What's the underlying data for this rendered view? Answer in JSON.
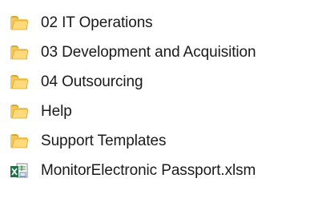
{
  "explorer": {
    "items": [
      {
        "name": "02 IT Operations",
        "icon": "folder-icon"
      },
      {
        "name": "03 Development and Acquisition",
        "icon": "folder-icon"
      },
      {
        "name": "04 Outsourcing",
        "icon": "folder-icon"
      },
      {
        "name": "Help",
        "icon": "folder-icon"
      },
      {
        "name": "Support Templates",
        "icon": "folder-icon"
      },
      {
        "name": "MonitorElectronic Passport.xlsm",
        "icon": "excel-macro-file-icon"
      }
    ]
  }
}
